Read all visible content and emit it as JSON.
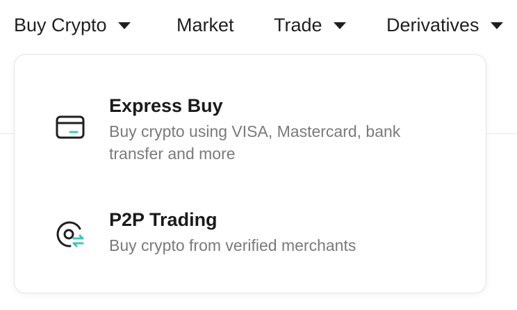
{
  "nav": {
    "items": [
      {
        "label": "Buy Crypto",
        "has_dropdown": true
      },
      {
        "label": "Market",
        "has_dropdown": false
      },
      {
        "label": "Trade",
        "has_dropdown": true
      },
      {
        "label": "Derivatives",
        "has_dropdown": true
      }
    ]
  },
  "dropdown": {
    "items": [
      {
        "title": "Express Buy",
        "description": "Buy crypto using VISA, Mastercard, bank transfer and more",
        "icon": "credit-card-icon"
      },
      {
        "title": "P2P Trading",
        "description": "Buy crypto from verified merchants",
        "icon": "p2p-exchange-icon"
      }
    ]
  },
  "colors": {
    "text": "#1f1f1f",
    "muted": "#7a7a7a",
    "accent": "#3ec7b3",
    "border": "#e4e4e4"
  }
}
